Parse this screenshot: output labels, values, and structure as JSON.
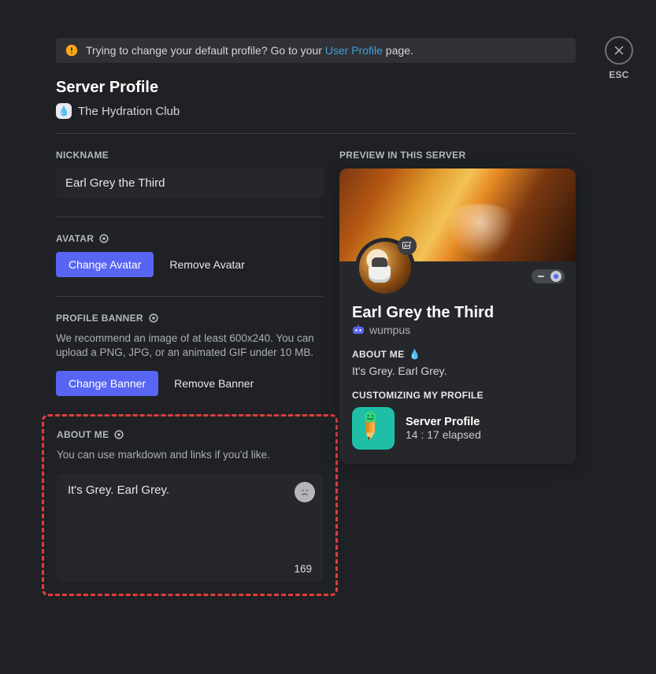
{
  "close_label": "ESC",
  "notice": {
    "text_before": "Trying to change your default profile? Go to your ",
    "link_text": "User Profile",
    "text_after": " page."
  },
  "page_title": "Server Profile",
  "server": {
    "name": "The Hydration Club"
  },
  "nickname": {
    "label": "NICKNAME",
    "value": "Earl Grey the Third"
  },
  "avatar": {
    "label": "AVATAR",
    "change": "Change Avatar",
    "remove": "Remove Avatar"
  },
  "banner": {
    "label": "PROFILE BANNER",
    "help": "We recommend an image of at least 600x240. You can upload a PNG, JPG, or an animated GIF under 10 MB.",
    "change": "Change Banner",
    "remove": "Remove Banner"
  },
  "about": {
    "label": "ABOUT ME",
    "help": "You can use markdown and links if you'd like.",
    "value": "It's Grey. Earl Grey.",
    "remaining": "169"
  },
  "preview": {
    "label": "PREVIEW IN THIS SERVER",
    "display_name": "Earl Grey the Third",
    "username": "wumpus",
    "about_label": "ABOUT ME",
    "about_text": "It's Grey. Earl Grey.",
    "activity_label": "CUSTOMIZING MY PROFILE",
    "activity_title": "Server Profile",
    "activity_sub": "14 : 17 elapsed"
  }
}
